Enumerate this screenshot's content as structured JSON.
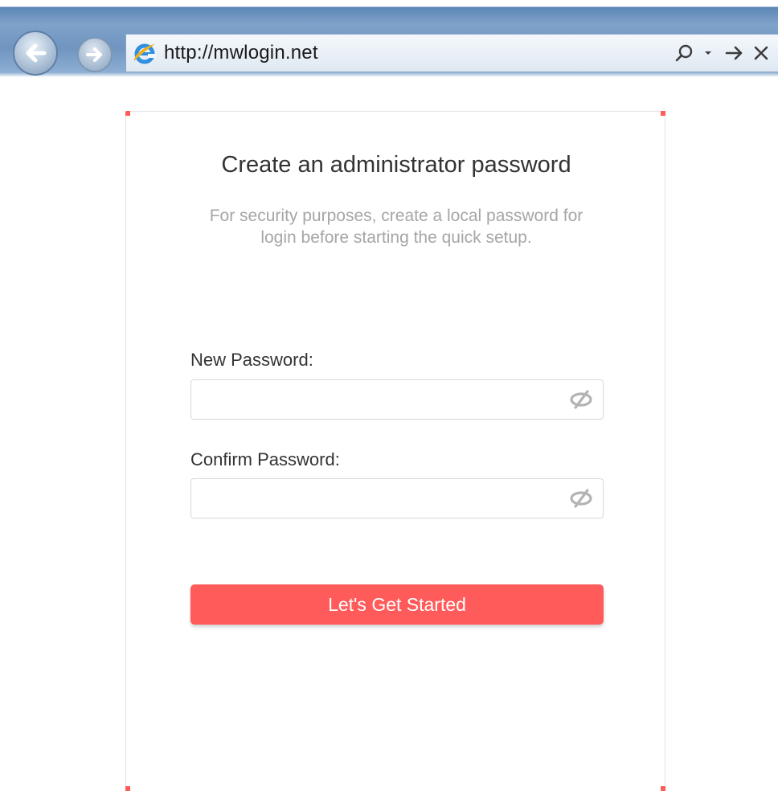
{
  "browser": {
    "url": "http://mwlogin.net",
    "icons": {
      "back": "back-arrow-icon",
      "forward": "forward-arrow-icon",
      "site": "ie-logo-icon",
      "search": "search-icon",
      "dropdown": "dropdown-caret-icon",
      "go": "go-arrow-icon",
      "stop": "stop-x-icon"
    }
  },
  "setup": {
    "title": "Create an administrator password",
    "subtitle": "For security purposes, create a local password for login before starting the quick setup.",
    "new_password_label": "New Password:",
    "new_password_value": "",
    "confirm_password_label": "Confirm Password:",
    "confirm_password_value": "",
    "eye_icon": "eye-slash-icon",
    "submit_label": "Let's Get Started"
  },
  "colors": {
    "accent": "#ff5b5b",
    "title_text": "#333333",
    "subtitle_text": "#a6a6a6",
    "field_border": "#d8d8d8"
  }
}
